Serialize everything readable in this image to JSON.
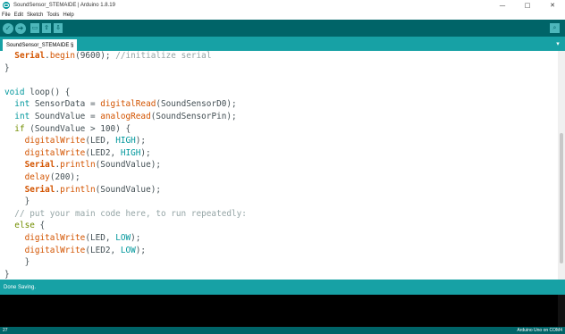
{
  "window": {
    "title": "SoundSensor_STEMAIDE | Arduino 1.8.19",
    "controls": {
      "minimize": "—",
      "maximize": "□",
      "close": "✕"
    }
  },
  "menu": [
    "File",
    "Edit",
    "Sketch",
    "Tools",
    "Help"
  ],
  "toolbar": {
    "verify": "✓",
    "upload": "➜",
    "new": "▭",
    "open": "⇧",
    "save": "⇩",
    "serial_monitor": "⌕"
  },
  "tab": {
    "label": "SoundSensor_STEMAIDE §",
    "menu": "▾"
  },
  "code_lines": [
    [
      [
        "  ",
        ""
      ],
      [
        "Serial",
        "bold"
      ],
      [
        ".",
        ""
      ],
      [
        "begin",
        "fn"
      ],
      [
        "(9600); ",
        ""
      ],
      [
        "//initialize serial",
        "cmt"
      ]
    ],
    [
      [
        "}",
        ""
      ]
    ],
    [
      [
        "",
        ""
      ]
    ],
    [
      [
        "void",
        "type"
      ],
      [
        " loop() {",
        ""
      ]
    ],
    [
      [
        "  ",
        ""
      ],
      [
        "int",
        "type"
      ],
      [
        " SensorData = ",
        ""
      ],
      [
        "digitalRead",
        "fn"
      ],
      [
        "(SoundSensorD0);",
        ""
      ]
    ],
    [
      [
        "  ",
        ""
      ],
      [
        "int",
        "type"
      ],
      [
        " SoundValue = ",
        ""
      ],
      [
        "analogRead",
        "fn"
      ],
      [
        "(SoundSensorPin);",
        ""
      ]
    ],
    [
      [
        "  ",
        ""
      ],
      [
        "if",
        "kw"
      ],
      [
        " (SoundValue > 100) {",
        ""
      ]
    ],
    [
      [
        "    ",
        ""
      ],
      [
        "digitalWrite",
        "fn"
      ],
      [
        "(LED, ",
        ""
      ],
      [
        "HIGH",
        "const"
      ],
      [
        ");",
        ""
      ]
    ],
    [
      [
        "    ",
        ""
      ],
      [
        "digitalWrite",
        "fn"
      ],
      [
        "(LED2, ",
        ""
      ],
      [
        "HIGH",
        "const"
      ],
      [
        ");",
        ""
      ]
    ],
    [
      [
        "    ",
        ""
      ],
      [
        "Serial",
        "bold"
      ],
      [
        ".",
        ""
      ],
      [
        "println",
        "fn"
      ],
      [
        "(SoundValue);",
        ""
      ]
    ],
    [
      [
        "    ",
        ""
      ],
      [
        "delay",
        "fn"
      ],
      [
        "(200);",
        ""
      ]
    ],
    [
      [
        "    ",
        ""
      ],
      [
        "Serial",
        "bold"
      ],
      [
        ".",
        ""
      ],
      [
        "println",
        "fn"
      ],
      [
        "(SoundValue);",
        ""
      ]
    ],
    [
      [
        "    }",
        ""
      ]
    ],
    [
      [
        "  ",
        ""
      ],
      [
        "// put your main code here, to run repeatedly:",
        "cmt"
      ]
    ],
    [
      [
        "  ",
        ""
      ],
      [
        "else",
        "kw"
      ],
      [
        " {",
        ""
      ]
    ],
    [
      [
        "    ",
        ""
      ],
      [
        "digitalWrite",
        "fn"
      ],
      [
        "(LED, ",
        ""
      ],
      [
        "LOW",
        "const"
      ],
      [
        ");",
        ""
      ]
    ],
    [
      [
        "    ",
        ""
      ],
      [
        "digitalWrite",
        "fn"
      ],
      [
        "(LED2, ",
        ""
      ],
      [
        "LOW",
        "const"
      ],
      [
        ");",
        ""
      ]
    ],
    [
      [
        "    }",
        ""
      ]
    ],
    [
      [
        "}",
        ""
      ]
    ]
  ],
  "status": {
    "message": "Done Saving."
  },
  "footer": {
    "line_number": "27",
    "board_port": "Arduino Uno on COM4"
  },
  "colors": {
    "toolbar": "#006468",
    "tabbar": "#17a1a5",
    "type": "#00979c",
    "keyword": "#728e00",
    "function": "#d35400",
    "comment": "#95a5a6"
  }
}
